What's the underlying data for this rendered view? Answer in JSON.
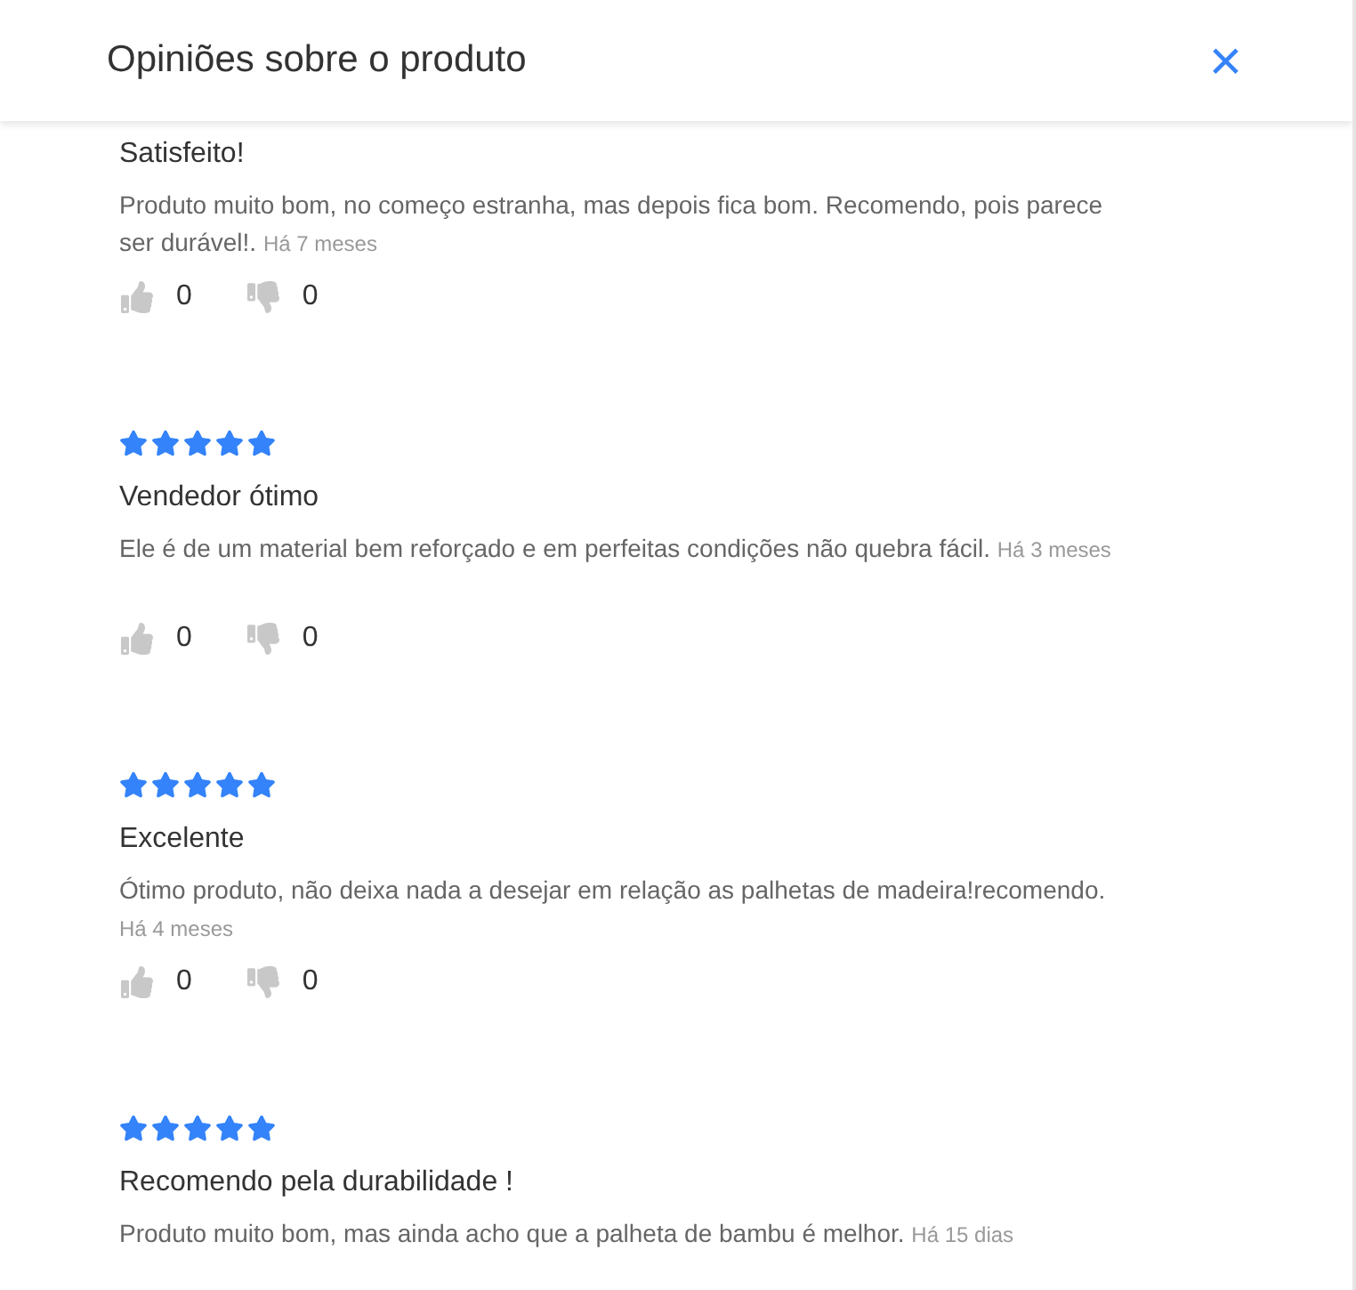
{
  "header": {
    "title": "Opiniões sobre o produto",
    "close": "×"
  },
  "reviews": [
    {
      "title": "Satisfeito!",
      "text": "Produto muito bom, no começo estranha, mas depois fica bom. Recomendo, pois parece ser durável!.",
      "date": "Há 7 meses",
      "likes": "0",
      "dislikes": "0"
    },
    {
      "stars": 5,
      "title": "Vendedor ótimo",
      "text": "Ele é de um material bem reforçado e em perfeitas condições não quebra fácil.",
      "date": "Há 3 meses",
      "likes": "0",
      "dislikes": "0"
    },
    {
      "stars": 5,
      "title": "Excelente",
      "text": "Ótimo produto, não deixa nada a desejar em relação as palhetas de madeira!recomendo.",
      "date": "Há 4 meses",
      "likes": "0",
      "dislikes": "0"
    },
    {
      "stars": 5,
      "title": "Recomendo pela durabilidade !",
      "text": "Produto muito bom, mas ainda acho que a palheta de bambu é melhor.",
      "date": "Há 15 dias"
    }
  ]
}
